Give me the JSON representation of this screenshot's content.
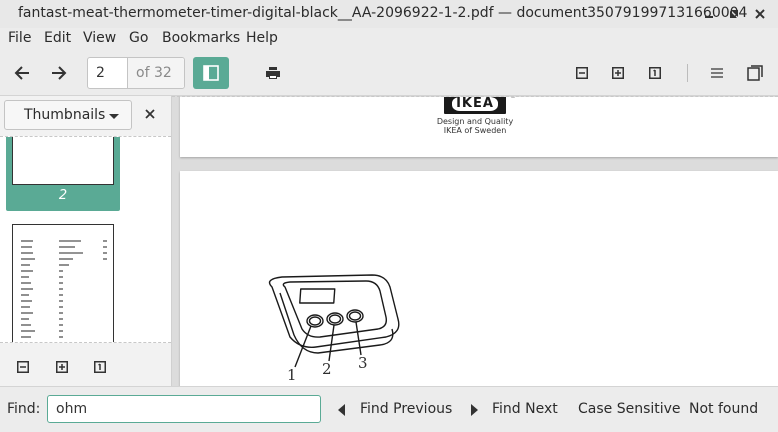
{
  "window": {
    "title": "fantast-meat-thermometer-timer-digital-black__AA-2096922-1-2.pdf — document350791997131660004"
  },
  "menu": {
    "items": [
      "File",
      "Edit",
      "View",
      "Go",
      "Bookmarks",
      "Help"
    ]
  },
  "toolbar": {
    "current_page": "2",
    "total_pages": "of 32"
  },
  "sidebar": {
    "mode": "Thumbnails",
    "selected_thumb_number": "2"
  },
  "document": {
    "brand": "IKEA",
    "tagline_1": "Design and Quality",
    "tagline_2": "IKEA of Sweden",
    "callouts": [
      "1",
      "2",
      "3"
    ]
  },
  "findbar": {
    "label": "Find:",
    "query": "ohm",
    "prev_label": "Find Previous",
    "next_label": "Find Next",
    "case_label": "Case Sensitive",
    "status": "Not found"
  },
  "colors": {
    "accent": "#5aaa95"
  }
}
